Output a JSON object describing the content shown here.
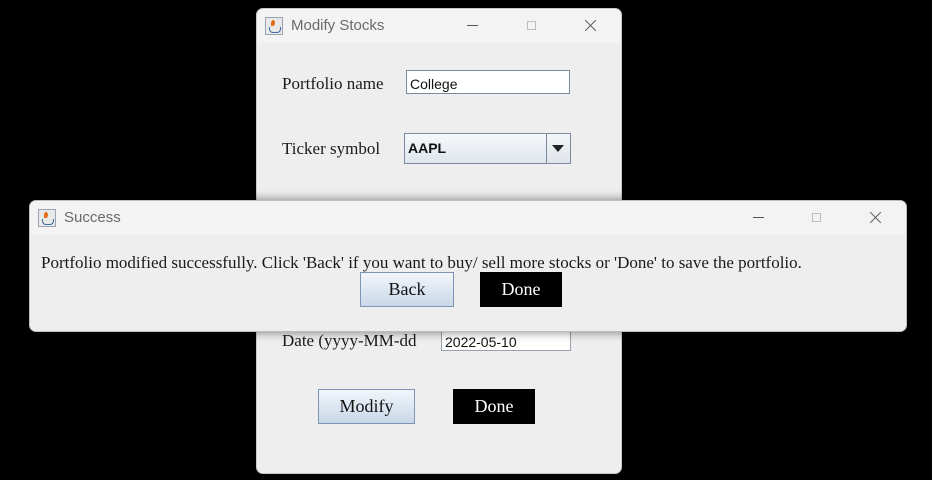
{
  "modify_window": {
    "title": "Modify Stocks",
    "portfolio_label": "Portfolio name",
    "portfolio_value": "College",
    "ticker_label": "Ticker symbol",
    "ticker_value": "AAPL",
    "date_label": "Date (yyyy-MM-dd",
    "date_value": "2022-05-10",
    "modify_button": "Modify",
    "done_button": "Done"
  },
  "success_dialog": {
    "title": "Success",
    "message": "Portfolio modified successfully. Click 'Back' if you want to buy/ sell more stocks or 'Done' to save the portfolio.",
    "back_button": "Back",
    "done_button": "Done"
  },
  "icons": {
    "app": "java-cup-icon",
    "minimize": "minimize-icon",
    "maximize": "maximize-icon",
    "close": "close-icon",
    "dropdown": "chevron-down-icon"
  },
  "colors": {
    "background": "#000000",
    "window": "#eeeeee",
    "dark_button": "#000000"
  }
}
